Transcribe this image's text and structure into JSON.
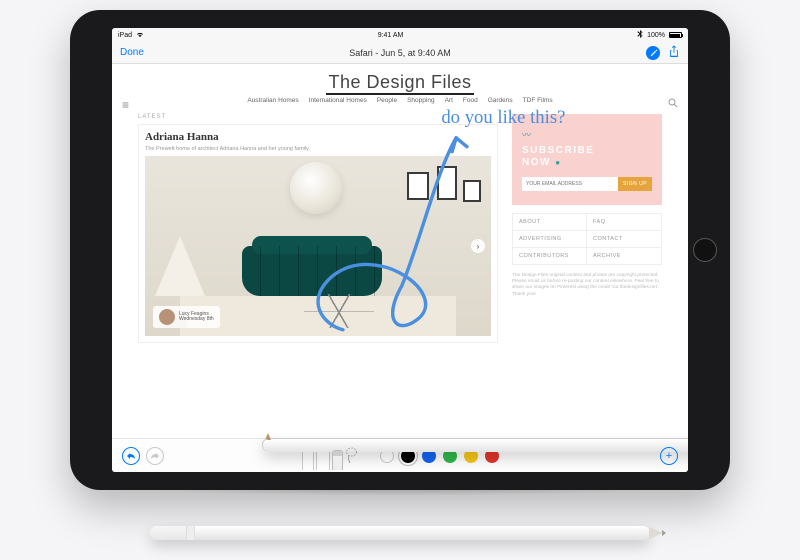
{
  "status": {
    "carrier": "iPad",
    "time": "9:41 AM",
    "battery": "100%"
  },
  "markup": {
    "done": "Done",
    "title": "Safari - Jun 5, at 9:40 AM"
  },
  "site": {
    "title": "The Design Files",
    "nav": [
      "Australian Homes",
      "International Homes",
      "People",
      "Shopping",
      "Art",
      "Food",
      "Gardens",
      "TDF Films"
    ],
    "latest": "LATEST",
    "articleTitle": "Adriana Hanna",
    "articleSub": "The Prewett home of architect Adriana Hanna and her young family.",
    "badgeName": "Lucy Feagins",
    "badgeDate": "Wednesday 8th",
    "subscribe1": "SUBSCRIBE",
    "subscribe2": "NOW",
    "emailPH": "YOUR EMAIL ADDRESS",
    "signup": "SIGN UP",
    "links": [
      "ABOUT",
      "FAQ",
      "ADVERTISING",
      "CONTACT",
      "CONTRIBUTORS",
      "ARCHIVE"
    ],
    "fine": "The Design Files original content and photos are copyright protected. Please email us before re-posting our content elsewhere. Feel free to share our images on Pinterest using the credit 'via thedesignfiles.net'. Thank you!"
  },
  "annotation": {
    "text": "do you like this?"
  },
  "tools": {
    "colors": [
      {
        "hex": "#ffffff",
        "sel": false,
        "stroke": "#ccc"
      },
      {
        "hex": "#000000",
        "sel": true
      },
      {
        "hex": "#1463ef",
        "sel": false
      },
      {
        "hex": "#2fb54a",
        "sel": false
      },
      {
        "hex": "#f5c518",
        "sel": false
      },
      {
        "hex": "#e0352b",
        "sel": false
      }
    ]
  }
}
